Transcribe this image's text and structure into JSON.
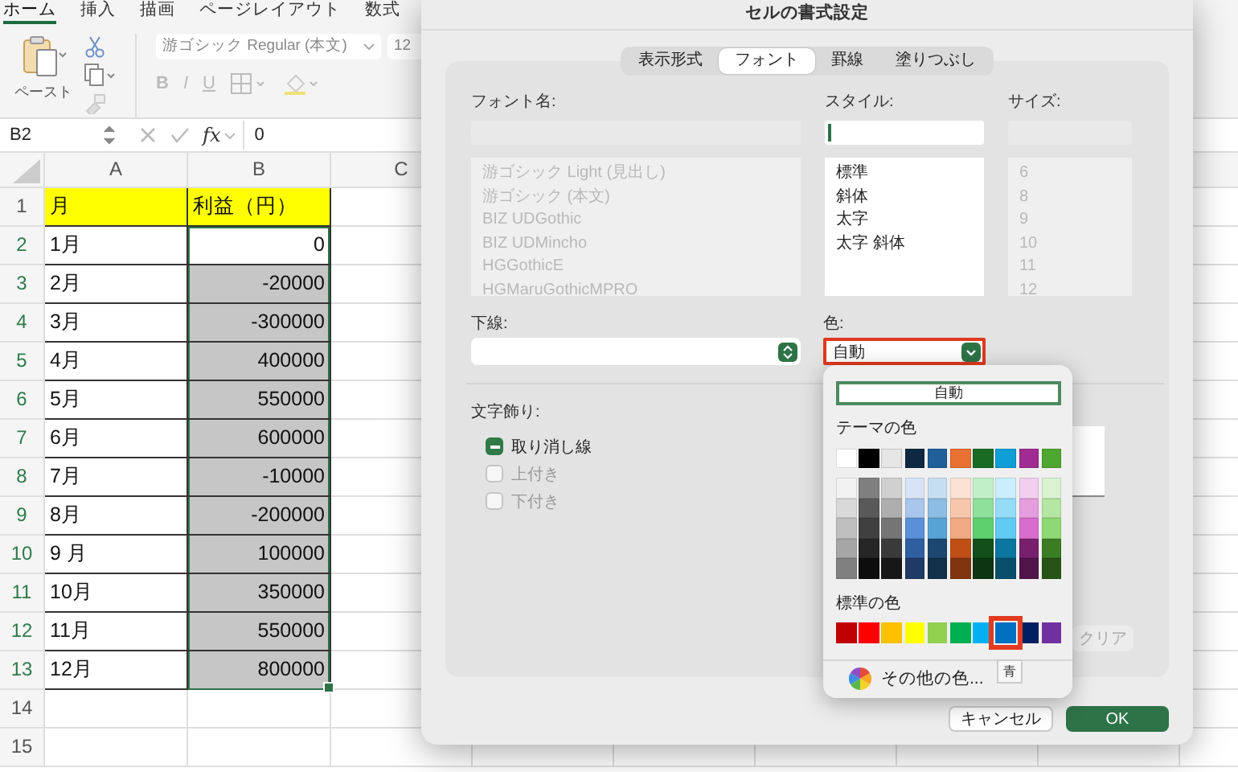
{
  "ribbon": {
    "tabs": [
      {
        "label": "ホーム",
        "selected": true
      },
      {
        "label": "挿入",
        "selected": false
      },
      {
        "label": "描画",
        "selected": false
      },
      {
        "label": "ページレイアウト",
        "selected": false
      },
      {
        "label": "数式",
        "selected": false
      }
    ],
    "paste_label": "ペースト",
    "font_name": "游ゴシック Regular (本文)",
    "font_size": "12",
    "format_buttons": [
      "B",
      "I",
      "U"
    ]
  },
  "formula_bar": {
    "cell_ref": "B2",
    "fx": "fx",
    "value": "0"
  },
  "sheet": {
    "columns": [
      "A",
      "B",
      "C"
    ],
    "rows": [
      {
        "number": "1",
        "kind": "header",
        "selected": false,
        "active": false,
        "cells": [
          "月",
          "利益（円）"
        ]
      },
      {
        "number": "2",
        "kind": "data",
        "selected": true,
        "active": true,
        "cells": [
          "1月",
          "0"
        ]
      },
      {
        "number": "3",
        "kind": "data",
        "selected": true,
        "active": false,
        "cells": [
          "2月",
          "-20000"
        ]
      },
      {
        "number": "4",
        "kind": "data",
        "selected": true,
        "active": false,
        "cells": [
          "3月",
          "-300000"
        ]
      },
      {
        "number": "5",
        "kind": "data",
        "selected": true,
        "active": false,
        "cells": [
          "4月",
          "400000"
        ]
      },
      {
        "number": "6",
        "kind": "data",
        "selected": true,
        "active": false,
        "cells": [
          "5月",
          "550000"
        ]
      },
      {
        "number": "7",
        "kind": "data",
        "selected": true,
        "active": false,
        "cells": [
          "6月",
          "600000"
        ]
      },
      {
        "number": "8",
        "kind": "data",
        "selected": true,
        "active": false,
        "cells": [
          "7月",
          "-10000"
        ]
      },
      {
        "number": "9",
        "kind": "data",
        "selected": true,
        "active": false,
        "cells": [
          "8月",
          "-200000"
        ]
      },
      {
        "number": "10",
        "kind": "data",
        "selected": true,
        "active": false,
        "cells": [
          "9 月",
          "100000"
        ]
      },
      {
        "number": "11",
        "kind": "data",
        "selected": true,
        "active": false,
        "cells": [
          "10月",
          "350000"
        ]
      },
      {
        "number": "12",
        "kind": "data",
        "selected": true,
        "active": false,
        "cells": [
          "11月",
          "550000"
        ]
      },
      {
        "number": "13",
        "kind": "data",
        "selected": true,
        "active": false,
        "cells": [
          "12月",
          "800000"
        ]
      }
    ],
    "empty_rows": [
      "14",
      "15"
    ]
  },
  "dialog": {
    "title": "セルの書式設定",
    "tabs": [
      {
        "label": "表示形式",
        "selected": false
      },
      {
        "label": "フォント",
        "selected": true
      },
      {
        "label": "罫線",
        "selected": false
      },
      {
        "label": "塗りつぶし",
        "selected": false
      }
    ],
    "font_name": {
      "label": "フォント名:",
      "disabled": true,
      "items": [
        "游ゴシック Light (見出し)",
        "游ゴシック (本文)",
        "BIZ UDGothic",
        "BIZ UDMincho",
        "HGGothicE",
        "HGMaruGothicMPRO"
      ]
    },
    "style": {
      "label": "スタイル:",
      "disabled": false,
      "items": [
        "標準",
        "斜体",
        "太字",
        "太字 斜体"
      ]
    },
    "size": {
      "label": "サイズ:",
      "disabled": true,
      "items": [
        "6",
        "8",
        "9",
        "10",
        "11",
        "12"
      ]
    },
    "underline": {
      "label": "下線:"
    },
    "color": {
      "label": "色:",
      "value": "自動",
      "highlighted": true
    },
    "effects": {
      "label": "文字飾り:",
      "items": [
        {
          "label": "取り消し線",
          "checked": true,
          "mixed": true,
          "disabled": false
        },
        {
          "label": "上付き",
          "checked": false,
          "mixed": false,
          "disabled": true
        },
        {
          "label": "下付き",
          "checked": false,
          "mixed": false,
          "disabled": true
        }
      ]
    },
    "clear_button": "クリア",
    "buttons": [
      {
        "label": "キャンセル",
        "kind": "secondary"
      },
      {
        "label": "OK",
        "kind": "primary"
      }
    ],
    "color_popover": {
      "auto_button": "自動",
      "theme_label": "テーマの色",
      "theme_colors": [
        {
          "color": "#ffffff",
          "shades": [
            {
              "color": "#f2f2f2"
            },
            {
              "color": "#d9d9d9"
            },
            {
              "color": "#bfbfbf"
            },
            {
              "color": "#a6a6a6"
            },
            {
              "color": "#808080"
            }
          ]
        },
        {
          "color": "#000000",
          "shades": [
            {
              "color": "#7f7f7f"
            },
            {
              "color": "#595959"
            },
            {
              "color": "#404040"
            },
            {
              "color": "#262626"
            },
            {
              "color": "#0d0d0d"
            }
          ]
        },
        {
          "color": "#e7e6e6",
          "shades": [
            {
              "color": "#d0d0d0"
            },
            {
              "color": "#aeaeae"
            },
            {
              "color": "#757575"
            },
            {
              "color": "#3a3a3a"
            },
            {
              "color": "#171717"
            }
          ]
        },
        {
          "color": "#0e2841",
          "shades": [
            {
              "color": "#d6e4f6"
            },
            {
              "color": "#a9c6ec"
            },
            {
              "color": "#5a90d8"
            },
            {
              "color": "#2f5fa0"
            },
            {
              "color": "#1f3a66"
            }
          ]
        },
        {
          "color": "#215f9a",
          "shades": [
            {
              "color": "#c6def1"
            },
            {
              "color": "#8dbde3"
            },
            {
              "color": "#58a3d6"
            },
            {
              "color": "#1b4770"
            },
            {
              "color": "#123049"
            }
          ]
        },
        {
          "color": "#e97132",
          "shades": [
            {
              "color": "#fbe2d5"
            },
            {
              "color": "#f7c7ac"
            },
            {
              "color": "#f1a983"
            },
            {
              "color": "#c04f15"
            },
            {
              "color": "#803510"
            }
          ]
        },
        {
          "color": "#196b24",
          "shades": [
            {
              "color": "#c1f0c8"
            },
            {
              "color": "#8ee09a"
            },
            {
              "color": "#5ed06d"
            },
            {
              "color": "#124f1a"
            },
            {
              "color": "#0c3511"
            }
          ]
        },
        {
          "color": "#0f9ed5",
          "shades": [
            {
              "color": "#caeefb"
            },
            {
              "color": "#95dcf7"
            },
            {
              "color": "#61cbf3"
            },
            {
              "color": "#0b76a0"
            },
            {
              "color": "#074f6a"
            }
          ]
        },
        {
          "color": "#a02b93",
          "shades": [
            {
              "color": "#f2ceef"
            },
            {
              "color": "#e49edd"
            },
            {
              "color": "#d86dcd"
            },
            {
              "color": "#77206d"
            },
            {
              "color": "#501549"
            }
          ]
        },
        {
          "color": "#4ea72e",
          "shades": [
            {
              "color": "#daf2d0"
            },
            {
              "color": "#b5e6a2"
            },
            {
              "color": "#8ed973"
            },
            {
              "color": "#3b7d23"
            },
            {
              "color": "#275317"
            }
          ]
        }
      ],
      "standard_label": "標準の色",
      "standard_colors": [
        {
          "color": "#c00000",
          "selected": false
        },
        {
          "color": "#ff0000",
          "selected": false
        },
        {
          "color": "#ffc000",
          "selected": false
        },
        {
          "color": "#ffff00",
          "selected": false
        },
        {
          "color": "#92d050",
          "selected": false
        },
        {
          "color": "#00b050",
          "selected": false
        },
        {
          "color": "#00b0f0",
          "selected": false
        },
        {
          "color": "#0070c0",
          "selected": true
        },
        {
          "color": "#002060",
          "selected": false
        },
        {
          "color": "#7030a0",
          "selected": false
        }
      ],
      "tooltip": "青",
      "more_colors": "その他の色..."
    }
  }
}
